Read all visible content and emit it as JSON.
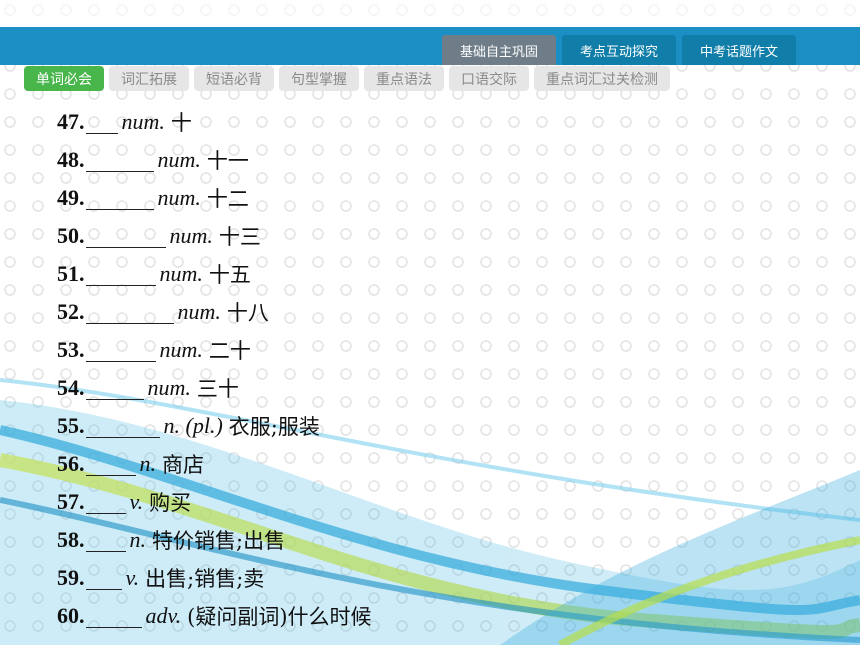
{
  "header": {
    "tabs": [
      {
        "label": "基础自主巩固",
        "active": true
      },
      {
        "label": "考点互动探究",
        "active": false
      },
      {
        "label": "中考话题作文",
        "active": false
      }
    ]
  },
  "subnav": {
    "tabs": [
      {
        "label": "单词必会",
        "active": true
      },
      {
        "label": "词汇拓展",
        "active": false
      },
      {
        "label": "短语必背",
        "active": false
      },
      {
        "label": "句型掌握",
        "active": false
      },
      {
        "label": "重点语法",
        "active": false
      },
      {
        "label": "口语交际",
        "active": false
      },
      {
        "label": "重点词汇过关检测",
        "active": false
      }
    ]
  },
  "items": [
    {
      "num": "47.",
      "pos": "num.",
      "meaning": "十"
    },
    {
      "num": "48.",
      "pos": "num.",
      "meaning": "十一"
    },
    {
      "num": "49.",
      "pos": "num.",
      "meaning": "十二"
    },
    {
      "num": "50.",
      "pos": "num.",
      "meaning": "十三"
    },
    {
      "num": "51.",
      "pos": "num.",
      "meaning": "十五"
    },
    {
      "num": "52.",
      "pos": "num.",
      "meaning": "十八"
    },
    {
      "num": "53.",
      "pos": "num.",
      "meaning": "二十"
    },
    {
      "num": "54.",
      "pos": "num.",
      "meaning": "三十"
    },
    {
      "num": "55.",
      "pos": "n. (pl.)",
      "meaning": "衣服;服装"
    },
    {
      "num": "56.",
      "pos": "n.",
      "meaning": "商店"
    },
    {
      "num": "57.",
      "pos": "v.",
      "meaning": "购买"
    },
    {
      "num": "58.",
      "pos": "n.",
      "meaning": "特价销售;出售"
    },
    {
      "num": "59.",
      "pos": "v.",
      "meaning": "出售;销售;卖"
    },
    {
      "num": "60.",
      "pos": "adv.",
      "meaning": "(疑问副词)什么时候"
    }
  ],
  "colors": {
    "topbar": "#1b8fc4",
    "active_subtab": "#49b64b",
    "active_toptab": "#6e7d88"
  }
}
